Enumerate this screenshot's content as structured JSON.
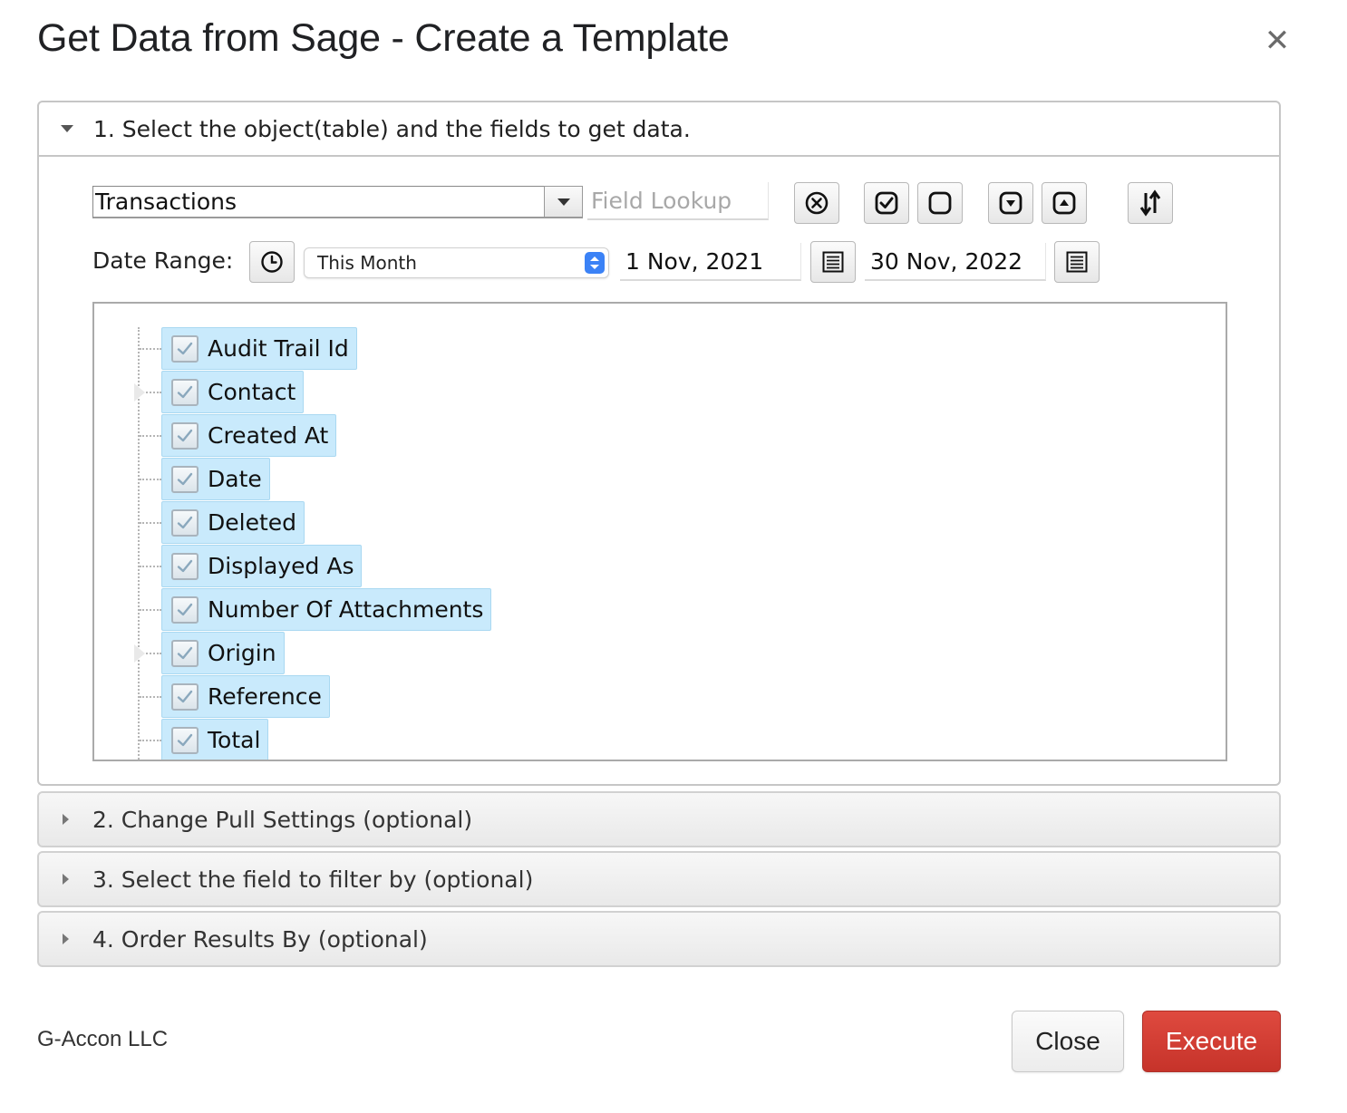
{
  "dialog": {
    "title": "Get Data from Sage - Create a Template",
    "close_icon": "close-x-icon"
  },
  "section1": {
    "title": "1. Select the object(table) and the fields to get data.",
    "object_select": {
      "value": "Transactions"
    },
    "field_lookup": {
      "placeholder": "Field Lookup",
      "value": ""
    },
    "toolbar_icons": [
      "clear-circle-x-icon",
      "check-all-icon",
      "uncheck-all-icon",
      "expand-all-icon",
      "collapse-all-icon",
      "sort-icon"
    ],
    "date_range": {
      "label": "Date Range:",
      "icon": "clock-icon",
      "preset": "This Month",
      "start": "1 Nov, 2021",
      "end": "30 Nov, 2022",
      "calendar_icon": "calendar-icon"
    },
    "fields": [
      {
        "label": "Audit Trail Id",
        "checked": true,
        "expandable": false
      },
      {
        "label": "Contact",
        "checked": true,
        "expandable": true
      },
      {
        "label": "Created At",
        "checked": true,
        "expandable": false
      },
      {
        "label": "Date",
        "checked": true,
        "expandable": false
      },
      {
        "label": "Deleted",
        "checked": true,
        "expandable": false
      },
      {
        "label": "Displayed As",
        "checked": true,
        "expandable": false
      },
      {
        "label": "Number Of Attachments",
        "checked": true,
        "expandable": false
      },
      {
        "label": "Origin",
        "checked": true,
        "expandable": true
      },
      {
        "label": "Reference",
        "checked": true,
        "expandable": false
      },
      {
        "label": "Total",
        "checked": true,
        "expandable": false
      }
    ]
  },
  "section2": {
    "title": "2. Change Pull Settings (optional)"
  },
  "section3": {
    "title": "3. Select the field to filter by (optional)"
  },
  "section4": {
    "title": "4. Order Results By (optional)"
  },
  "footer": {
    "company": "G-Accon LLC",
    "close_label": "Close",
    "execute_label": "Execute"
  },
  "colors": {
    "execute": "#d23f36",
    "field_highlight": "#c9eafc",
    "preset_arrow": "#3b82f6"
  }
}
